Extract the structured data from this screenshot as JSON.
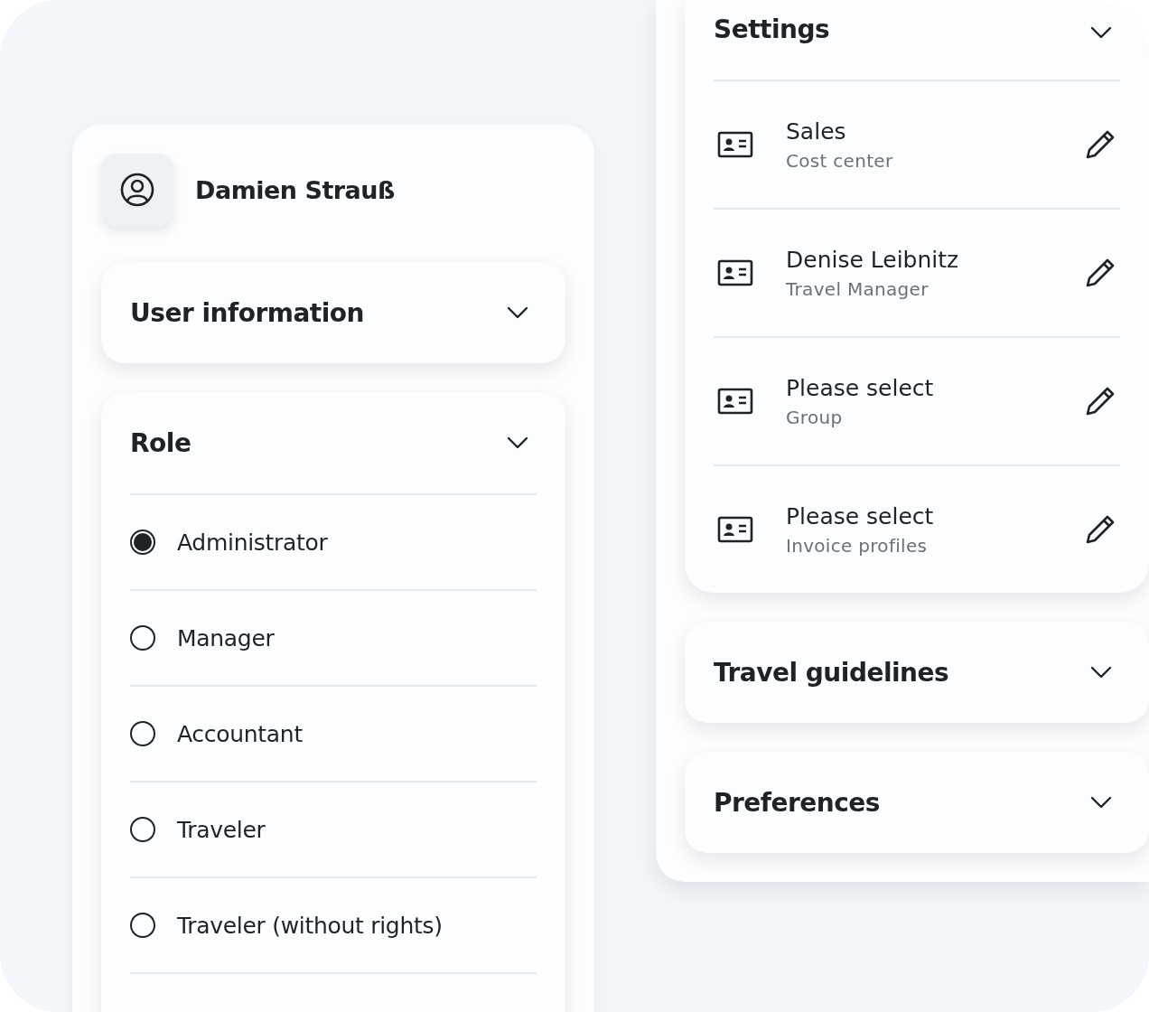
{
  "profile": {
    "name": "Damien Strauß"
  },
  "user_information": {
    "title": "User information"
  },
  "role": {
    "title": "Role",
    "options": [
      {
        "label": "Administrator",
        "selected": true
      },
      {
        "label": "Manager",
        "selected": false
      },
      {
        "label": "Accountant",
        "selected": false
      },
      {
        "label": "Traveler",
        "selected": false
      },
      {
        "label": "Traveler (without rights)",
        "selected": false
      }
    ]
  },
  "settings": {
    "title": "Settings",
    "items": [
      {
        "value": "Sales",
        "label": "Cost center"
      },
      {
        "value": "Denise Leibnitz",
        "label": "Travel Manager"
      },
      {
        "value": "Please select",
        "label": "Group"
      },
      {
        "value": "Please select",
        "label": "Invoice profiles"
      }
    ]
  },
  "collapsed_sections": [
    {
      "title": "Travel guidelines"
    },
    {
      "title": "Preferences"
    }
  ]
}
